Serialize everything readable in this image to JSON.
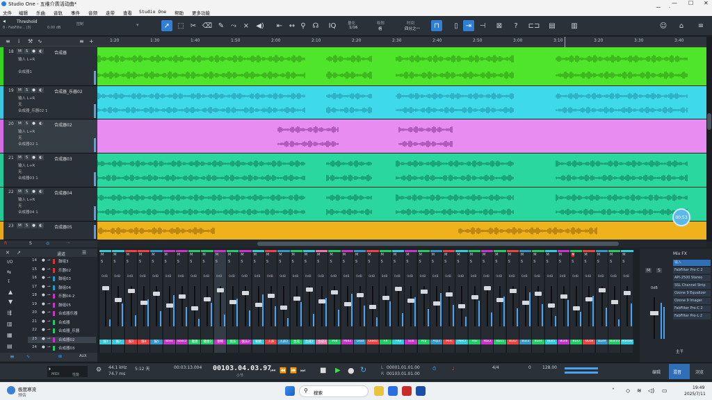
{
  "window": {
    "title": "Studio One - 五维介质活动曲*",
    "app_icon": "studio-one-logo"
  },
  "menu": [
    "文件",
    "编辑",
    "乐曲",
    "音轨",
    "事件",
    "音频",
    "走带",
    "查看",
    "Studio One",
    "帮助",
    "更多功能"
  ],
  "ime": {
    "label": "英"
  },
  "toolbar": {
    "preset_name": "Threshold",
    "preset_sub": "8 - FabFilte... (3)",
    "db": "0.00 dB",
    "mode_label": "控制",
    "quantize": "量化",
    "quantize_val": "1/16",
    "snap": "吸附",
    "snap_val": "格",
    "timebase": "时间",
    "timebase_val": "四分之一"
  },
  "ruler": [
    "1:20",
    "1:30",
    "1:40",
    "1:50",
    "2:00",
    "2:10",
    "2:20",
    "2:30",
    "2:40",
    "2:50",
    "3:00",
    "3:10",
    "3:20",
    "3:30",
    "3:40"
  ],
  "tracks": [
    {
      "num": "18",
      "name": "合成器",
      "input": "输入 L+R",
      "out": "合成器1",
      "color": "#35d41f",
      "lane": "#4fe52a",
      "wave": "#2b8a14"
    },
    {
      "num": "19",
      "name": "合成器_乐器02",
      "input": "输入 L+R",
      "sub": "无",
      "out": "合成器_乐器02 1",
      "color": "#39c6e3",
      "lane": "#3fd9ec",
      "wave": "#1d8aa0"
    },
    {
      "num": "20",
      "name": "合成器02",
      "input": "输入 L+R",
      "sub": "无",
      "out": "合成器02 1",
      "color": "#d26ce0",
      "lane": "#e88cf2",
      "wave": "#7a2b86"
    },
    {
      "num": "21",
      "name": "合成器03",
      "input": "输入 L+R",
      "sub": "无",
      "out": "合成器03 1",
      "color": "#23c996",
      "lane": "#2ad89f",
      "wave": "#0f6e4e"
    },
    {
      "num": "22",
      "name": "合成器04",
      "input": "输入 L+R",
      "sub": "无",
      "out": "合成器04 1",
      "color": "#23c996",
      "lane": "#2ad89f",
      "wave": "#0f6e4e"
    },
    {
      "num": "23",
      "name": "合成器05",
      "input": "",
      "sub": "",
      "out": "",
      "color": "#e7a818",
      "lane": "#f0b21c",
      "wave": "#8a5e06"
    }
  ],
  "time_badge": "00:53",
  "mixer_list": [
    {
      "n": "14",
      "name": "鼓组3",
      "c": "#d33"
    },
    {
      "n": "15",
      "name": "乐器02",
      "c": "#d33"
    },
    {
      "n": "16",
      "name": "鼓组03",
      "c": "#29c"
    },
    {
      "n": "17",
      "name": "鼓组04",
      "c": "#29c"
    },
    {
      "n": "18",
      "name": "乐器04-2",
      "c": "#c3c"
    },
    {
      "n": "19",
      "name": "鼓组05",
      "c": "#c3c"
    },
    {
      "n": "20",
      "name": "合成器乐器",
      "c": "#c3c"
    },
    {
      "n": "21",
      "name": "合成器",
      "c": "#2c6"
    },
    {
      "n": "22",
      "name": "合成器_乐器",
      "c": "#2c6"
    },
    {
      "n": "23",
      "name": "合成器02",
      "c": "#c3c"
    },
    {
      "n": "24",
      "name": "合成器03",
      "c": "#2c6"
    }
  ],
  "mixer_header": "通道",
  "fx": {
    "title": "Mix FX",
    "items": [
      "输入",
      "FabFilter Pro-C 2",
      "API-2500 Stereo",
      "SSL Channel Strip",
      "Ozone 9 Equalizer",
      "Ozone 9 Imager",
      "FabFilter Pro-C 2",
      "FabFilter Pro-L 2"
    ],
    "out": "主干",
    "master_db": "0dB"
  },
  "strip_labels": [
    "鼓1",
    "鼓2",
    "鼓3",
    "鼓4",
    "鼓5",
    "Bass",
    "Bass2",
    "键盘",
    "键盘2",
    "钢琴",
    "弦乐",
    "弦乐2",
    "铜管",
    "人声",
    "人声2",
    "合成",
    "合成2",
    "合成3",
    "Pad",
    "Pad2",
    "Lead",
    "Lead2",
    "FX",
    "FX2",
    "Sub",
    "Arp",
    "Arp2",
    "Perc",
    "Perc2",
    "Vox",
    "Vox2",
    "Bus1",
    "Bus2",
    "Bus3",
    "Bus4",
    "Bus5",
    "Bus6",
    "Bus7",
    "Bus8",
    "Bus9",
    "Bus10",
    "Master"
  ],
  "transport": {
    "sample_rate": "44.1 kHz",
    "latency": "74.7 ms",
    "length": "5:12 天",
    "time": "00:03:13.004",
    "bars": "00103.04.03.97",
    "bars_sub": "小节",
    "loop_l": "00001.01.01.00",
    "loop_r": "00103.01.01.00",
    "signature": "4/4",
    "tempo": "128.00",
    "key": "0",
    "midi_label": "MIDI",
    "perf_label": "性能"
  },
  "bottom_tabs": [
    "编辑",
    "混音",
    "浏览"
  ],
  "taskbar": {
    "weather_label": "极度寒流",
    "weather_sub": "预告",
    "search": "搜索",
    "clock": "19:49",
    "date": "2025/7/11"
  }
}
